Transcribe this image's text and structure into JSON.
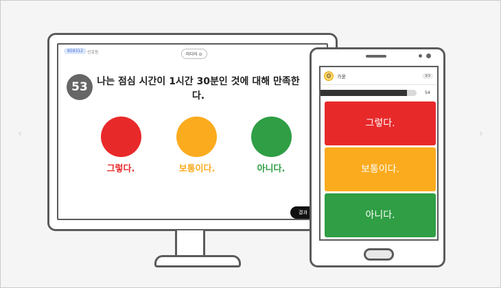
{
  "colors": {
    "red": "#e8292a",
    "yellow": "#fbab1e",
    "green": "#2f9e44",
    "dark": "#333333"
  },
  "desktop": {
    "room_code": "859312",
    "host": "신호등",
    "media_button": "미디어 ⊙",
    "question_number": "53",
    "question_text": "나는 점심 시간이 1시간 30분인 것에 대해 만족한다.",
    "options": [
      {
        "label": "그렇다.",
        "color": "#e8292a"
      },
      {
        "label": "보통이다.",
        "color": "#fbab1e"
      },
      {
        "label": "아니다.",
        "color": "#2f9e44"
      }
    ],
    "result_button": "결과"
  },
  "mobile": {
    "user_name": "가윤",
    "pill": "3/3",
    "progress_percent": 90,
    "question_number": "54",
    "options": [
      {
        "label": "그렇다.",
        "color": "#e8292a"
      },
      {
        "label": "보통이다.",
        "color": "#fbab1e"
      },
      {
        "label": "아니다.",
        "color": "#2f9e44"
      }
    ]
  }
}
